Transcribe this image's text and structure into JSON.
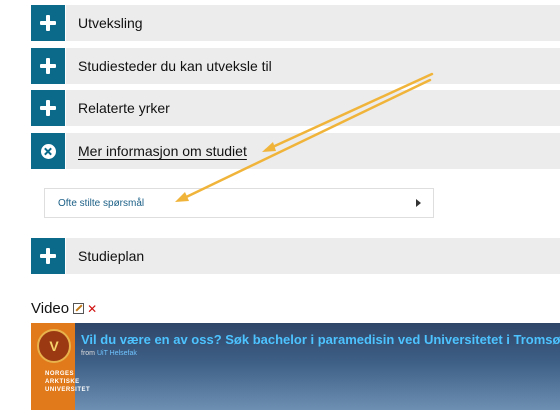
{
  "accordion": {
    "items": [
      {
        "label": "Utveksling",
        "state": "collapsed",
        "icon": "plus-icon"
      },
      {
        "label": "Studiesteder du kan utveksle til",
        "state": "collapsed",
        "icon": "plus-icon"
      },
      {
        "label": "Relaterte yrker",
        "state": "collapsed",
        "icon": "plus-icon"
      },
      {
        "label": "Mer informasjon om studiet",
        "state": "expanded",
        "icon": "close-circle-icon"
      },
      {
        "label": "Studieplan",
        "state": "collapsed",
        "icon": "plus-icon"
      }
    ],
    "expanded_content": {
      "link_label": "Ofte stilte spørsmål"
    }
  },
  "video_section": {
    "heading": "Video",
    "video_title": "Vil du være en av oss? Søk bachelor i paramedisin ved Universitetet i Tromsø",
    "from_prefix": "from",
    "channel": "UiT Helsefak",
    "logo_text": "NORGES ARKTISKE UNIVERSITET"
  },
  "colors": {
    "accent": "#0b6a8a",
    "bar_bg": "#ececec",
    "annotation_arrow": "#f0b43a"
  }
}
